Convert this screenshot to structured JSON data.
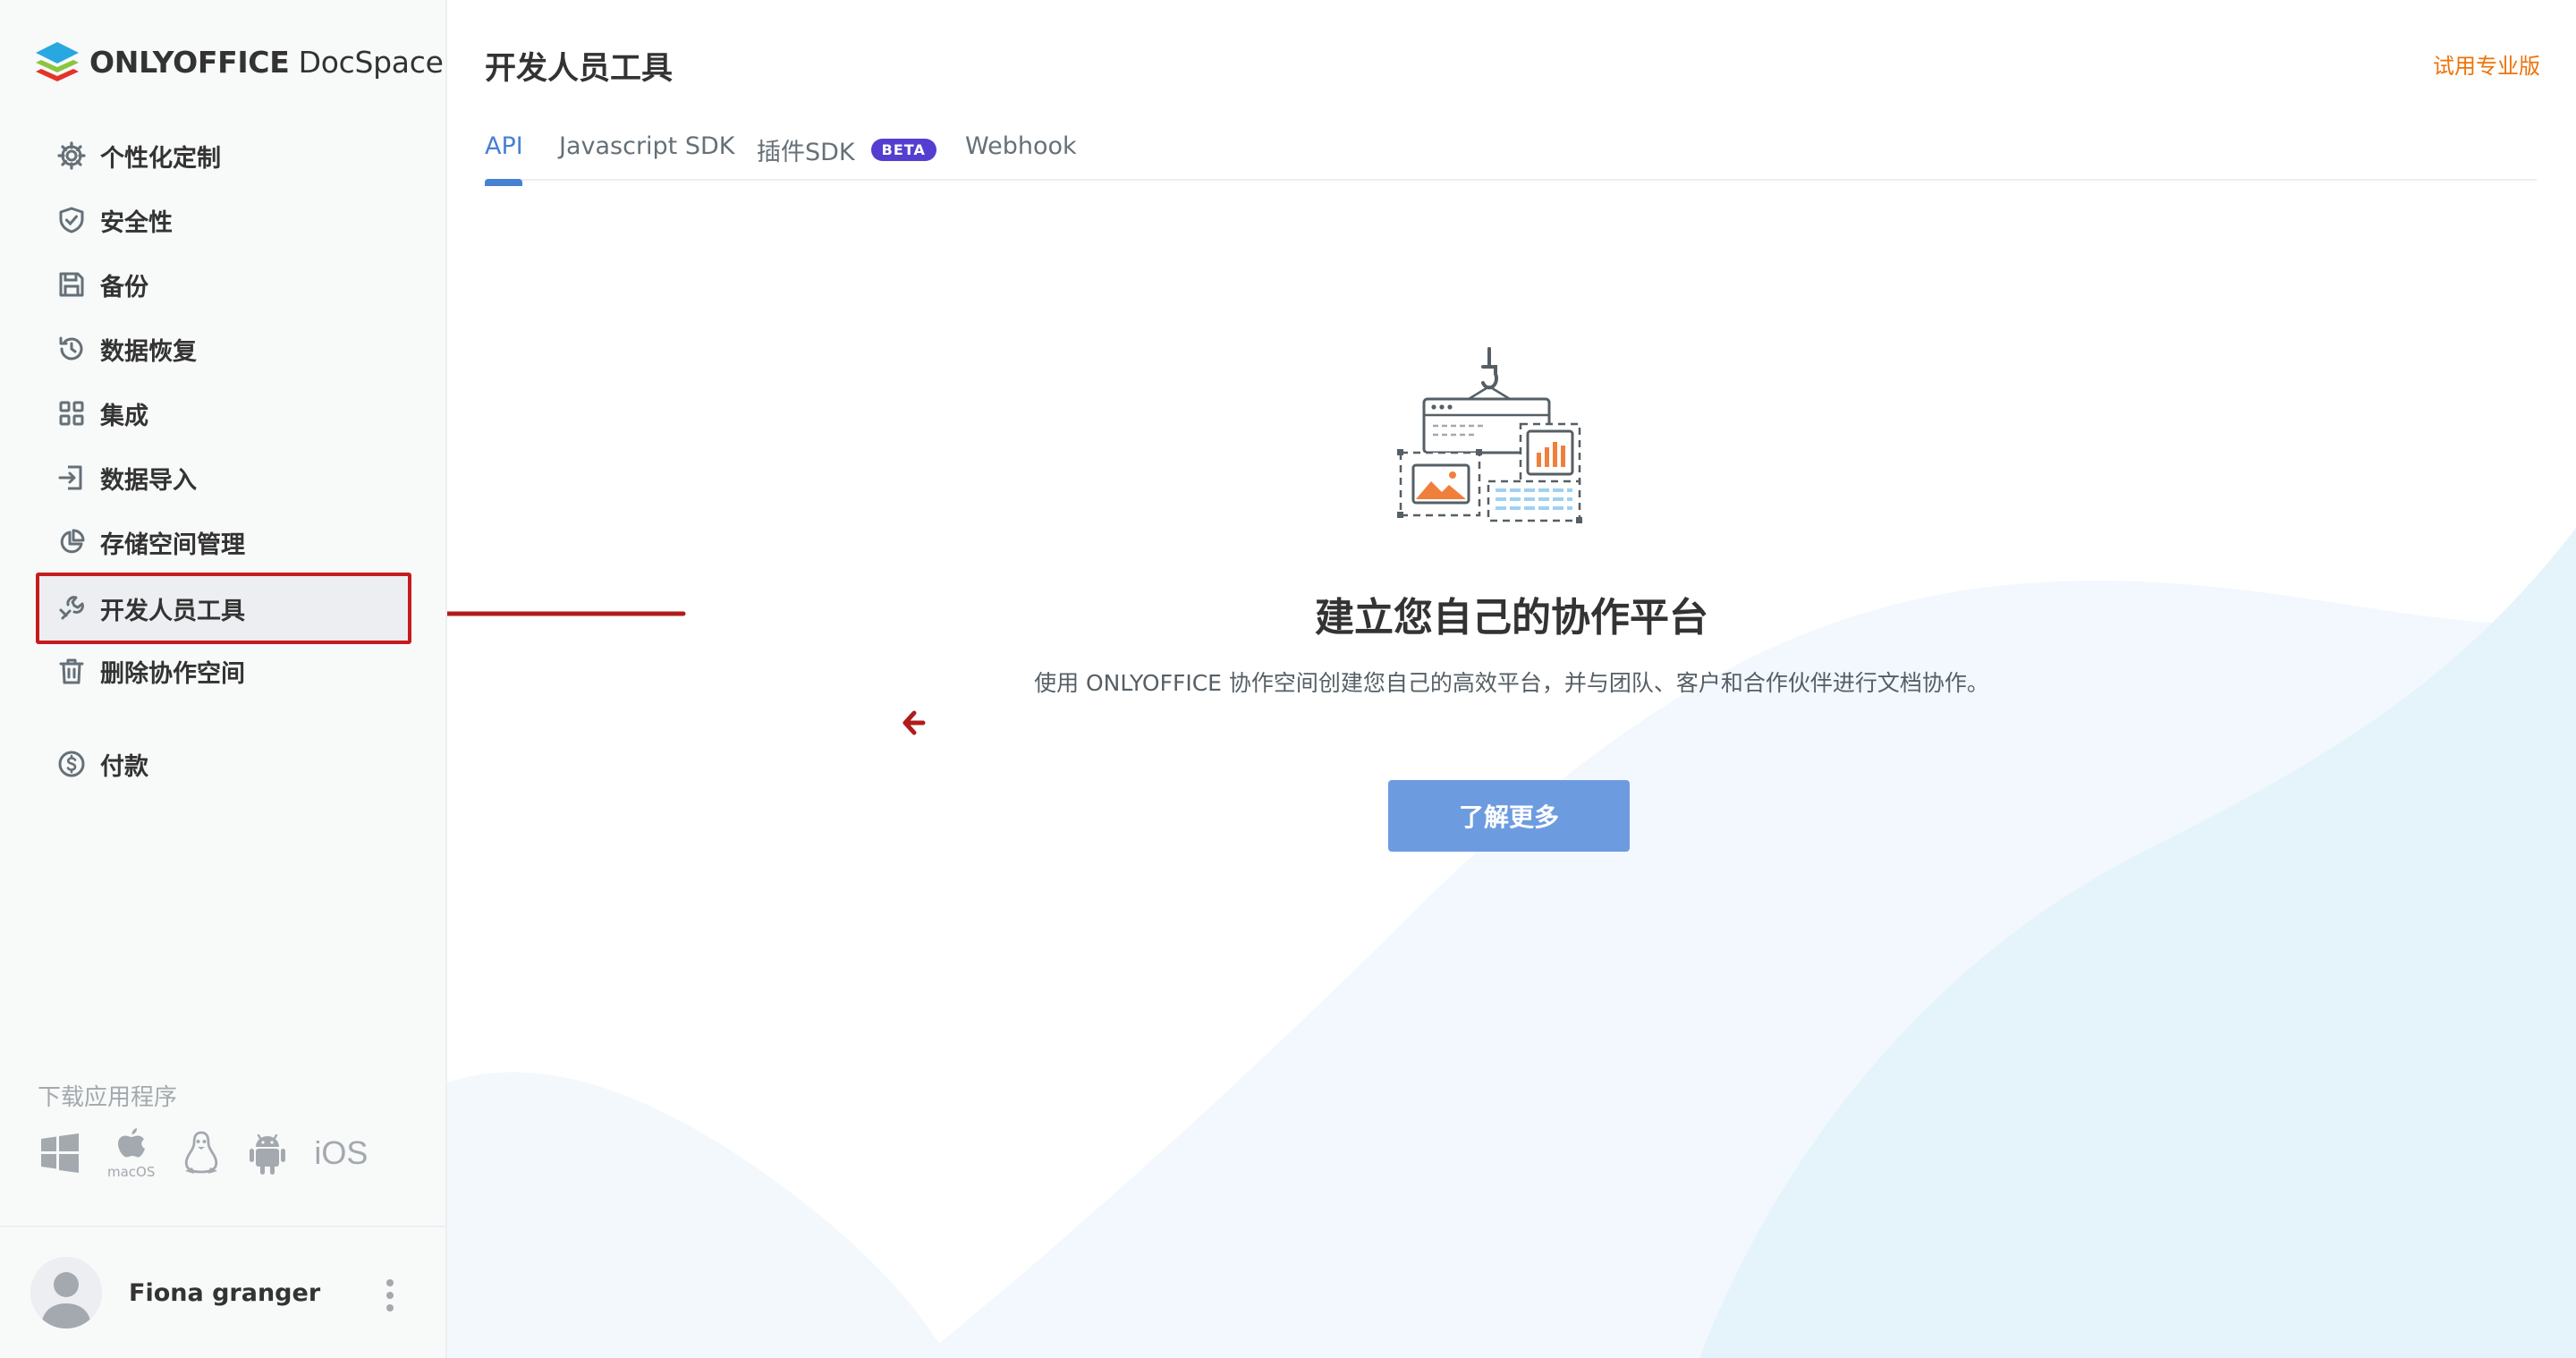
{
  "brand": {
    "bold": "ONLYOFFICE",
    "rest": " DocSpace"
  },
  "sidebar": {
    "items": [
      {
        "label": "个性化定制",
        "icon": "gear-icon"
      },
      {
        "label": "安全性",
        "icon": "shield-icon"
      },
      {
        "label": "备份",
        "icon": "floppy-icon"
      },
      {
        "label": "数据恢复",
        "icon": "history-icon"
      },
      {
        "label": "集成",
        "icon": "grid-icon"
      },
      {
        "label": "数据导入",
        "icon": "import-icon"
      },
      {
        "label": "存储空间管理",
        "icon": "pie-icon"
      },
      {
        "label": "开发人员工具",
        "icon": "developer-tools-icon",
        "active": true
      },
      {
        "label": "删除协作空间",
        "icon": "trash-icon"
      },
      {
        "label": "付款",
        "icon": "dollar-icon"
      }
    ],
    "download_title": "下载应用程序",
    "apps": {
      "macos": "macOS",
      "ios": "iOS"
    }
  },
  "profile": {
    "name": "Fiona granger"
  },
  "header": {
    "title": "开发人员工具",
    "trial": "试用专业版"
  },
  "tabs": [
    {
      "label": "API",
      "active": true
    },
    {
      "label": "Javascript SDK"
    },
    {
      "label": "插件SDK",
      "badge": "BETA"
    },
    {
      "label": "Webhook"
    }
  ],
  "empty": {
    "title": "建立您自己的协作平台",
    "description": "使用 ONLYOFFICE 协作空间创建您自己的高效平台，并与团队、客户和合作伙伴进行文档协作。",
    "button": "了解更多"
  },
  "colors": {
    "accent": "#4781d1",
    "button": "#6d9be0",
    "trial": "#ed7309",
    "beta": "#533ed1",
    "annotation": "#b01c1c"
  }
}
